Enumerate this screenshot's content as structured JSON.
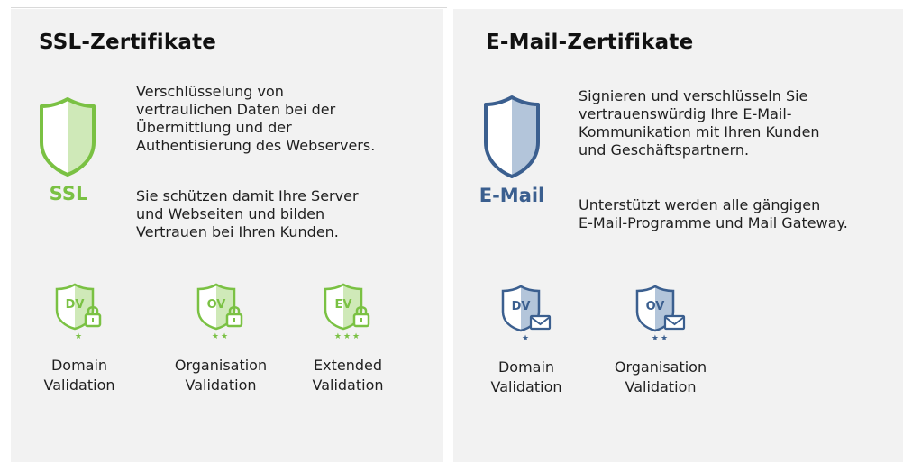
{
  "ssl": {
    "title": "SSL-Zertifikate",
    "icon_label": "SSL",
    "description": [
      "Verschlüsselung von",
      "vertraulichen Daten bei der",
      "Übermittlung und der",
      "Authentisierung des Webservers."
    ],
    "description2": [
      "Sie schützen damit Ihre Server",
      "und Webseiten und bilden",
      "Vertrauen bei Ihren Kunden."
    ],
    "accent": "#7ac143",
    "badges": [
      {
        "code": "DV",
        "stars": "★",
        "label": [
          "Domain",
          "Validation"
        ],
        "icon": "shield-lock-icon"
      },
      {
        "code": "OV",
        "stars": "★★",
        "label": [
          "Organisation",
          "Validation"
        ],
        "icon": "shield-lock-icon"
      },
      {
        "code": "EV",
        "stars": "★★★",
        "label": [
          "Extended",
          "Validation"
        ],
        "icon": "shield-lock-icon"
      }
    ]
  },
  "email": {
    "title": "E-Mail-Zertifikate",
    "icon_label": "E-Mail",
    "description": [
      "Signieren und verschlüsseln Sie",
      "vertrauenswürdig Ihre E-Mail-",
      "Kommunikation mit Ihren Kunden",
      "und Geschäftspartnern."
    ],
    "description2": [
      "Unterstützt werden alle gängigen",
      "E-Mail-Programme und Mail Gateway."
    ],
    "accent": "#3b5f8f",
    "badges": [
      {
        "code": "DV",
        "stars": "★",
        "label": [
          "Domain",
          "Validation"
        ],
        "icon": "shield-envelope-icon"
      },
      {
        "code": "OV",
        "stars": "★★",
        "label": [
          "Organisation",
          "Validation"
        ],
        "icon": "shield-envelope-icon"
      }
    ]
  }
}
